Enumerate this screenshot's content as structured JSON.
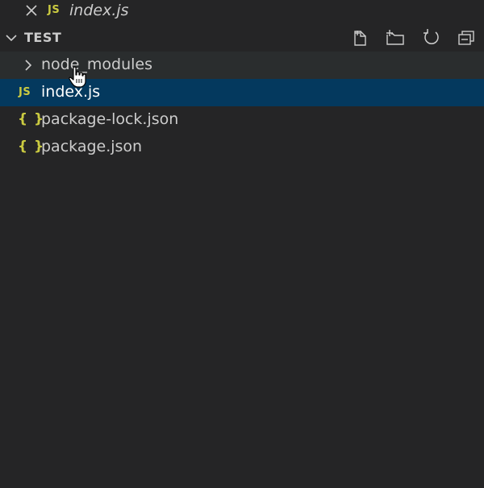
{
  "open_editors": {
    "items": [
      {
        "icon": "js-icon",
        "icon_text": "JS",
        "name": "index.js",
        "close_icon": "close-icon"
      }
    ]
  },
  "workspace": {
    "title": "TEST",
    "expanded": true,
    "toolbar": [
      {
        "icon": "new-file-icon",
        "label": "New File"
      },
      {
        "icon": "new-folder-icon",
        "label": "New Folder"
      },
      {
        "icon": "refresh-icon",
        "label": "Refresh Explorer"
      },
      {
        "icon": "collapse-all-icon",
        "label": "Collapse Folders in Explorer"
      }
    ]
  },
  "tree": {
    "items": [
      {
        "type": "folder",
        "name": "node_modules",
        "expanded": false,
        "hovered": true
      },
      {
        "type": "file",
        "name": "index.js",
        "icon": "js-icon",
        "icon_text": "JS",
        "selected": true
      },
      {
        "type": "file",
        "name": "package-lock.json",
        "icon": "json-icon",
        "icon_text": "{ }"
      },
      {
        "type": "file",
        "name": "package.json",
        "icon": "json-icon",
        "icon_text": "{ }"
      }
    ]
  },
  "colors": {
    "background": "#252526",
    "selection": "#04395e",
    "hover": "#2a2d2e",
    "text": "#cccccc",
    "icon_yellow": "#cbcb41"
  }
}
